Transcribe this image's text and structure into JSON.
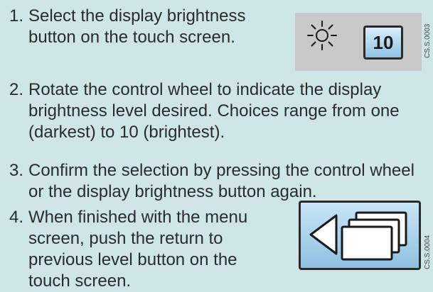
{
  "steps": [
    {
      "num": "1.",
      "text": "Select the display brightness button on the touch screen."
    },
    {
      "num": "2.",
      "text": "Rotate the control wheel to indicate the display brightness level desired. Choices range from one (darkest) to 10 (brightest)."
    },
    {
      "num": "3.",
      "text": "Confirm the selection by pressing the control wheel or the display brightness button again."
    },
    {
      "num": "4.",
      "text": "When finished with the menu screen, push the return to previous level button on the touch screen."
    }
  ],
  "figures": {
    "brightness": {
      "icon": "sun-icon",
      "button_value": "10",
      "code": "CS.S.0003"
    },
    "return": {
      "icon": "return-to-previous-level-icon",
      "code": "CS.S.0004"
    }
  },
  "colors": {
    "background": "#cfe6e8",
    "button_fill": "#a8d3ee",
    "figure_panel": "#c9c9c9"
  }
}
